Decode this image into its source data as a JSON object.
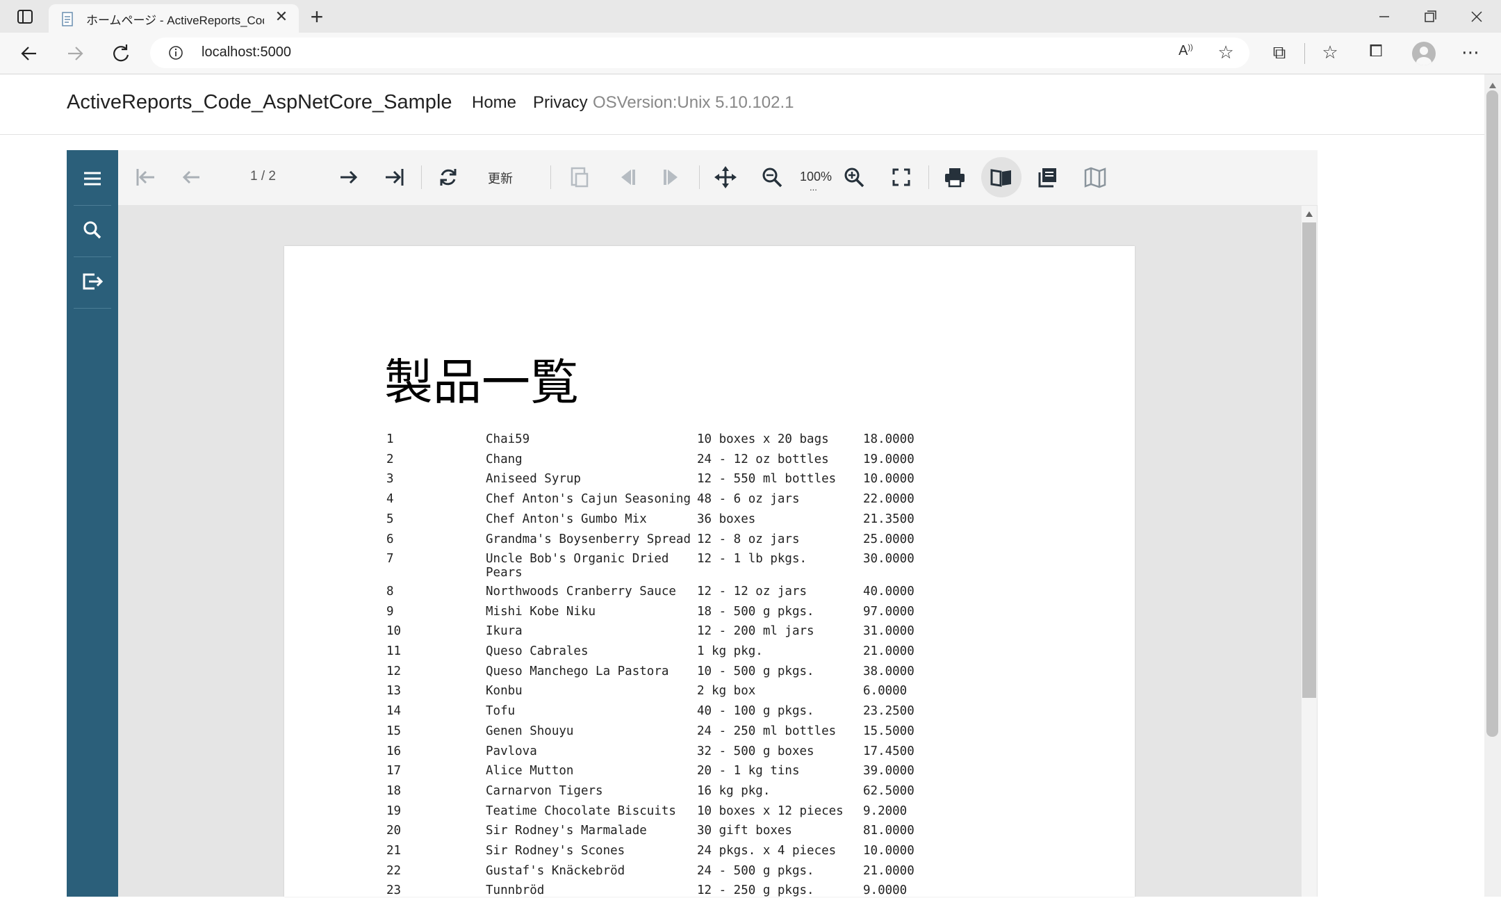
{
  "browser": {
    "tab_title": "ホームページ - ActiveReports_Code",
    "address": "localhost:5000"
  },
  "site": {
    "brand": "ActiveReports_Code_AspNetCore_Sample",
    "nav": [
      {
        "label": "Home"
      },
      {
        "label": "Privacy"
      }
    ],
    "os_version": "OSVersion:Unix 5.10.102.1"
  },
  "viewer": {
    "page_indicator": "1 / 2",
    "refresh_label": "更新",
    "zoom": "100%",
    "zoom_more": "...",
    "colors": {
      "sidebar": "#2b5f7a",
      "toolbar": "#f4f4f4",
      "background": "#e5e5e5"
    }
  },
  "report": {
    "title": "製品一覧",
    "rows": [
      {
        "id": "1",
        "name": "Chai59",
        "qty": "10 boxes x 20 bags",
        "price": "18.0000"
      },
      {
        "id": "2",
        "name": "Chang",
        "qty": "24 - 12 oz bottles",
        "price": "19.0000"
      },
      {
        "id": "3",
        "name": "Aniseed Syrup",
        "qty": "12 - 550 ml bottles",
        "price": "10.0000"
      },
      {
        "id": "4",
        "name": "Chef Anton's Cajun Seasoning",
        "qty": "48 - 6 oz jars",
        "price": "22.0000"
      },
      {
        "id": "5",
        "name": "Chef Anton's Gumbo Mix",
        "qty": "36 boxes",
        "price": "21.3500"
      },
      {
        "id": "6",
        "name": "Grandma's Boysenberry Spread",
        "qty": "12 - 8 oz jars",
        "price": "25.0000"
      },
      {
        "id": "7",
        "name": "Uncle Bob's Organic Dried",
        "name2": "Pears",
        "qty": "12 - 1 lb pkgs.",
        "price": "30.0000"
      },
      {
        "id": "8",
        "name": "Northwoods Cranberry Sauce",
        "qty": "12 - 12 oz jars",
        "price": "40.0000"
      },
      {
        "id": "9",
        "name": "Mishi Kobe Niku",
        "qty": "18 - 500 g pkgs.",
        "price": "97.0000"
      },
      {
        "id": "10",
        "name": "Ikura",
        "qty": "12 - 200 ml jars",
        "price": "31.0000"
      },
      {
        "id": "11",
        "name": "Queso Cabrales",
        "qty": "1 kg pkg.",
        "price": "21.0000"
      },
      {
        "id": "12",
        "name": "Queso Manchego La Pastora",
        "qty": "10 - 500 g pkgs.",
        "price": "38.0000"
      },
      {
        "id": "13",
        "name": "Konbu",
        "qty": "2 kg box",
        "price": "6.0000"
      },
      {
        "id": "14",
        "name": "Tofu",
        "qty": "40 - 100 g pkgs.",
        "price": "23.2500"
      },
      {
        "id": "15",
        "name": "Genen Shouyu",
        "qty": "24 - 250 ml bottles",
        "price": "15.5000"
      },
      {
        "id": "16",
        "name": "Pavlova",
        "qty": "32 - 500 g boxes",
        "price": "17.4500"
      },
      {
        "id": "17",
        "name": "Alice Mutton",
        "qty": "20 - 1 kg tins",
        "price": "39.0000"
      },
      {
        "id": "18",
        "name": "Carnarvon Tigers",
        "qty": "16 kg pkg.",
        "price": "62.5000"
      },
      {
        "id": "19",
        "name": "Teatime Chocolate Biscuits",
        "qty": "10 boxes x 12 pieces",
        "price": "9.2000"
      },
      {
        "id": "20",
        "name": "Sir Rodney's Marmalade",
        "qty": "30 gift boxes",
        "price": "81.0000"
      },
      {
        "id": "21",
        "name": "Sir Rodney's Scones",
        "qty": "24 pkgs. x 4 pieces",
        "price": "10.0000"
      },
      {
        "id": "22",
        "name": "Gustaf's Knäckebröd",
        "qty": "24 - 500 g pkgs.",
        "price": "21.0000"
      },
      {
        "id": "23",
        "name": "Tunnbröd",
        "qty": "12 - 250 g pkgs.",
        "price": "9.0000"
      }
    ]
  }
}
